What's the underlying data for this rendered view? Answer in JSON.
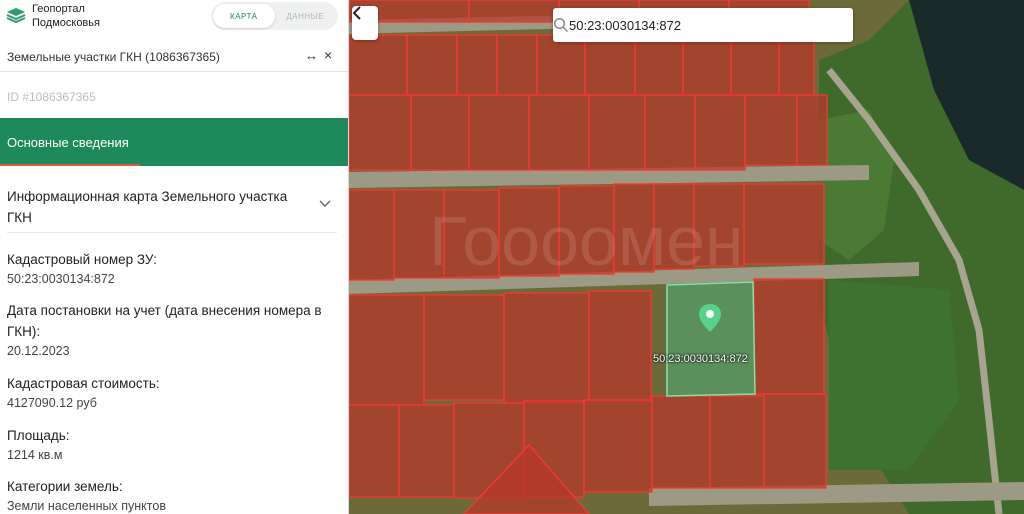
{
  "brand": {
    "line1": "Геопортал",
    "line2": "Подмосковья"
  },
  "mode_toggle": {
    "map_label": "КАРТА",
    "data_label": "ДАННЫЕ",
    "active": "map"
  },
  "panel": {
    "title": "Земельные участки ГКН (1086367365)",
    "expand_glyph": "↔",
    "close_glyph": "×",
    "id_text": "ID #1086367365",
    "section_label": "Основные сведения",
    "info_card_title": "Информационная карта Земельного участка ГКН",
    "fields": [
      {
        "key": "Кадастровый номер ЗУ:",
        "value": "50:23:0030134:872"
      },
      {
        "key": "Дата постановки на учет (дата внесения номера в ГКН):",
        "value": "20.12.2023"
      },
      {
        "key": "Кадастровая стоимость:",
        "value": "4127090.12 руб"
      },
      {
        "key": "Площадь:",
        "value": "1214 кв.м"
      },
      {
        "key": "Категории земель:",
        "value": "Земли населенных пунктов"
      }
    ]
  },
  "map": {
    "search_value": "50:23:0030134:872",
    "selected_parcel_label": "50:23:0030134:872",
    "watermark": "Гоооомен"
  },
  "colors": {
    "accent": "#1e8a5c",
    "section_underline": "#e05a3a",
    "parcel_fill": "#c0392b",
    "parcel_border": "#e53935",
    "selected_parcel_fill": "#4caf7a"
  },
  "icons": {
    "logo": "layers-icon",
    "expand": "expand-icon",
    "close": "close-icon",
    "chevron": "chevron-down-icon",
    "back": "chevron-left-icon",
    "search": "search-icon",
    "pin": "location-pin-icon"
  }
}
